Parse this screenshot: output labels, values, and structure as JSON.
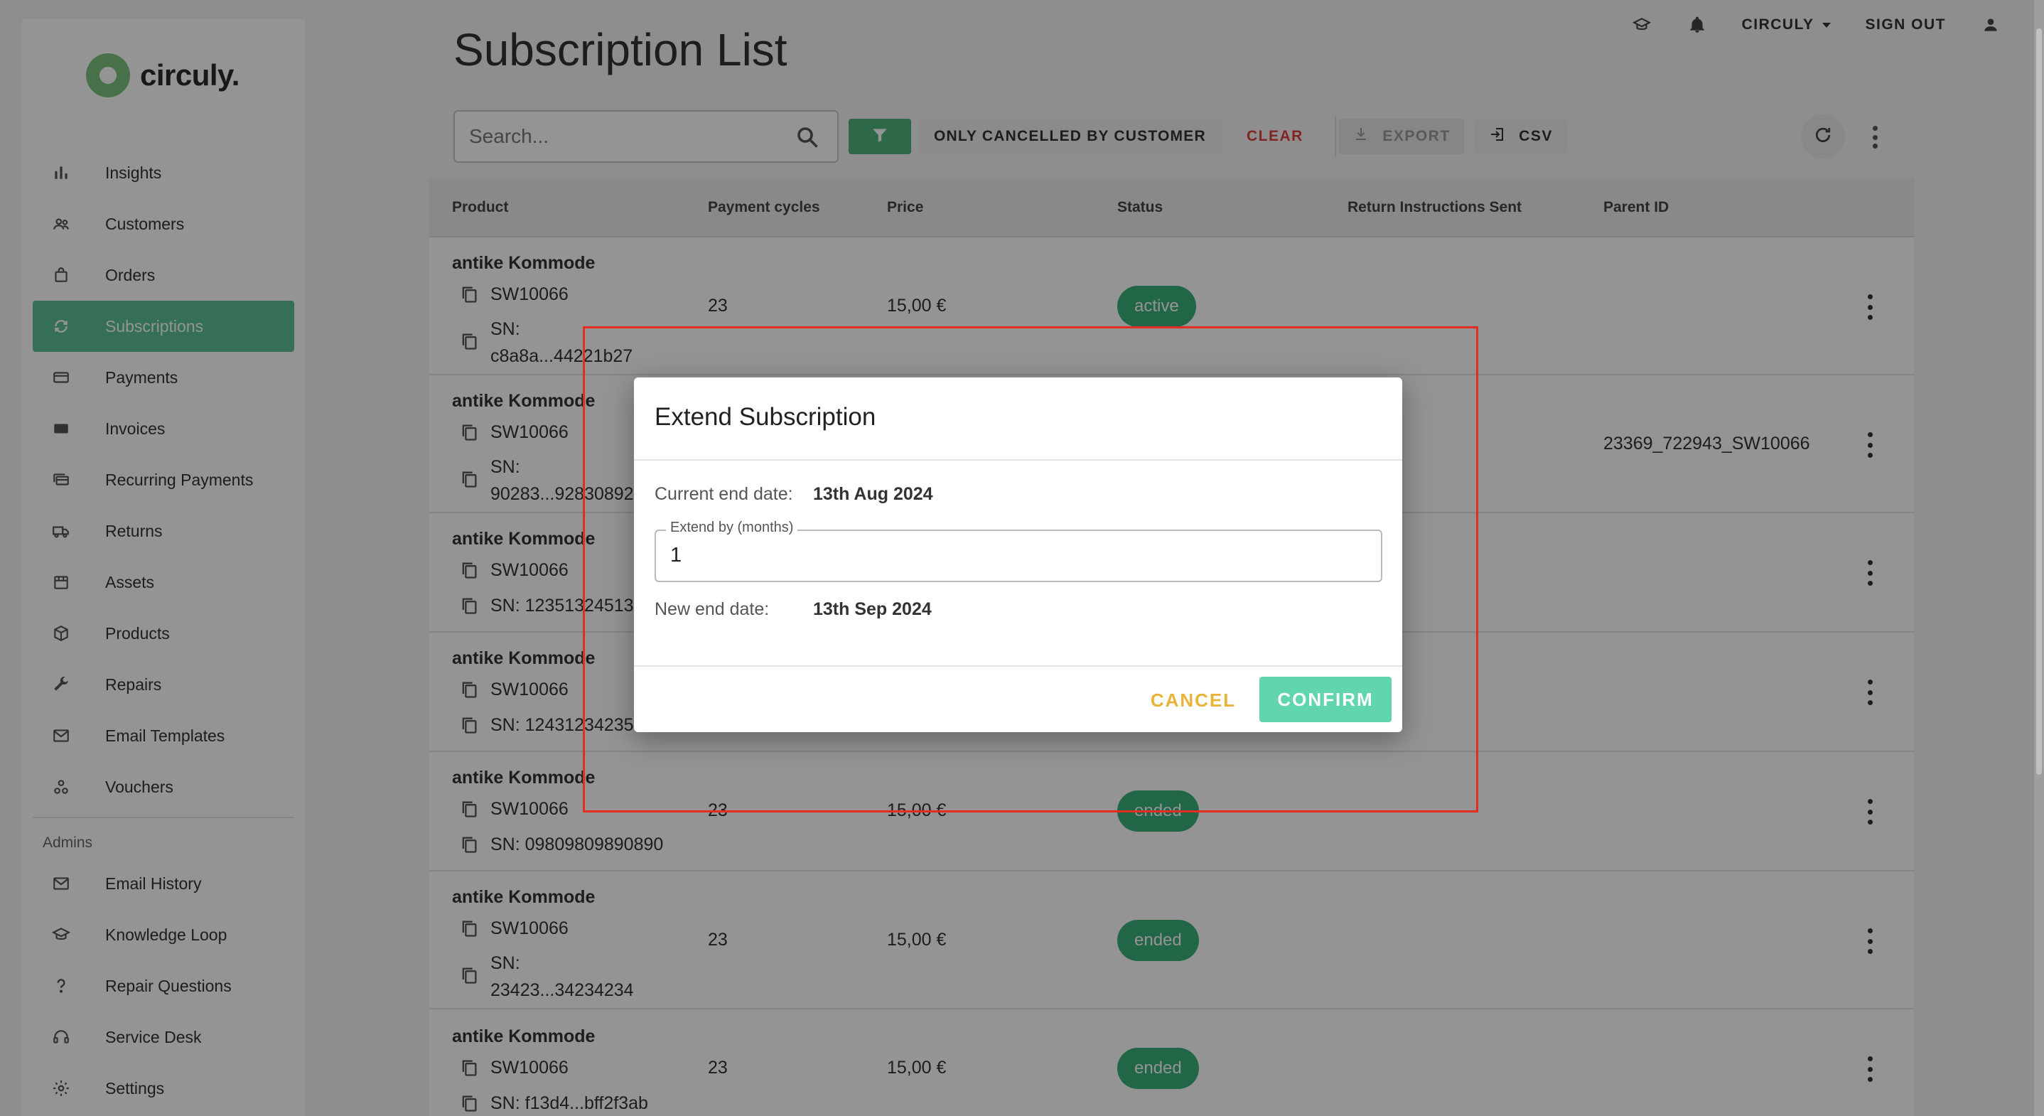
{
  "brand": {
    "name": "circuly."
  },
  "sidebar": {
    "items": [
      {
        "label": "Insights",
        "icon": "bar-chart-icon",
        "active": false
      },
      {
        "label": "Customers",
        "icon": "users-icon",
        "active": false
      },
      {
        "label": "Orders",
        "icon": "shopping-bag-icon",
        "active": false
      },
      {
        "label": "Subscriptions",
        "icon": "sync-icon",
        "active": true
      },
      {
        "label": "Payments",
        "icon": "credit-card-icon",
        "active": false
      },
      {
        "label": "Invoices",
        "icon": "invoice-icon",
        "active": false
      },
      {
        "label": "Recurring Payments",
        "icon": "recurring-payment-icon",
        "active": false
      },
      {
        "label": "Returns",
        "icon": "truck-icon",
        "active": false
      },
      {
        "label": "Assets",
        "icon": "store-icon",
        "active": false
      },
      {
        "label": "Products",
        "icon": "box-icon",
        "active": false
      },
      {
        "label": "Repairs",
        "icon": "wrench-icon",
        "active": false
      },
      {
        "label": "Email Templates",
        "icon": "mail-icon",
        "active": false
      },
      {
        "label": "Vouchers",
        "icon": "voucher-icon",
        "active": false
      }
    ],
    "admins_label": "Admins",
    "admin_items": [
      {
        "label": "Email History",
        "icon": "mail-icon"
      },
      {
        "label": "Knowledge Loop",
        "icon": "graduation-cap-icon"
      },
      {
        "label": "Repair Questions",
        "icon": "question-icon"
      },
      {
        "label": "Service Desk",
        "icon": "headset-icon"
      },
      {
        "label": "Settings",
        "icon": "gear-icon"
      }
    ]
  },
  "topbar": {
    "account": "CIRCULY",
    "sign_out": "SIGN OUT"
  },
  "main": {
    "title": "Subscription List",
    "search_placeholder": "Search...",
    "filter_chip": "ONLY CANCELLED BY CUSTOMER",
    "clear": "CLEAR",
    "export": "EXPORT",
    "csv": "CSV"
  },
  "table": {
    "columns": [
      "Product",
      "Payment cycles",
      "Price",
      "Status",
      "Return Instructions Sent",
      "Parent ID"
    ],
    "rows": [
      {
        "product": "antike Kommode",
        "sku": "SW10066",
        "sn_prefix": "SN:",
        "sn": "c8a8a...44221b27",
        "cycles": "23",
        "price": "15,00 €",
        "status": "active",
        "parent_id": ""
      },
      {
        "product": "antike Kommode",
        "sku": "SW10066",
        "sn_prefix": "SN:",
        "sn": "90283...92830892",
        "cycles": "",
        "price": "",
        "status": "",
        "parent_id": "23369_722943_SW10066"
      },
      {
        "product": "antike Kommode",
        "sku": "SW10066",
        "sn_prefix": "SN: 12351324513",
        "sn": "",
        "cycles": "",
        "price": "",
        "status": "",
        "parent_id": ""
      },
      {
        "product": "antike Kommode",
        "sku": "SW10066",
        "sn_prefix": "SN: 12431234235",
        "sn": "",
        "cycles": "",
        "price": "",
        "status": "",
        "parent_id": ""
      },
      {
        "product": "antike Kommode",
        "sku": "SW10066",
        "sn_prefix": "SN: 09809809890890",
        "sn": "",
        "cycles": "23",
        "price": "15,00 €",
        "status": "ended",
        "parent_id": ""
      },
      {
        "product": "antike Kommode",
        "sku": "SW10066",
        "sn_prefix": "SN:",
        "sn": "23423...34234234",
        "cycles": "23",
        "price": "15,00 €",
        "status": "ended",
        "parent_id": ""
      },
      {
        "product": "antike Kommode",
        "sku": "SW10066",
        "sn_prefix": "SN: f13d4...bff2f3ab",
        "sn": "",
        "cycles": "23",
        "price": "15,00 €",
        "status": "ended",
        "parent_id": ""
      }
    ]
  },
  "dialog": {
    "title": "Extend Subscription",
    "current_end_label": "Current end date:",
    "current_end_value": "13th Aug 2024",
    "extend_label": "Extend by (months)",
    "extend_value": "1",
    "new_end_label": "New end date:",
    "new_end_value": "13th Sep 2024",
    "cancel": "CANCEL",
    "confirm": "CONFIRM"
  },
  "colors": {
    "accent": "#5bbf95",
    "status_badge": "#3ab07b",
    "confirm": "#61d6ad",
    "cancel": "#e9b33a",
    "clear": "#e1403a",
    "highlight_frame": "#e32d22"
  }
}
